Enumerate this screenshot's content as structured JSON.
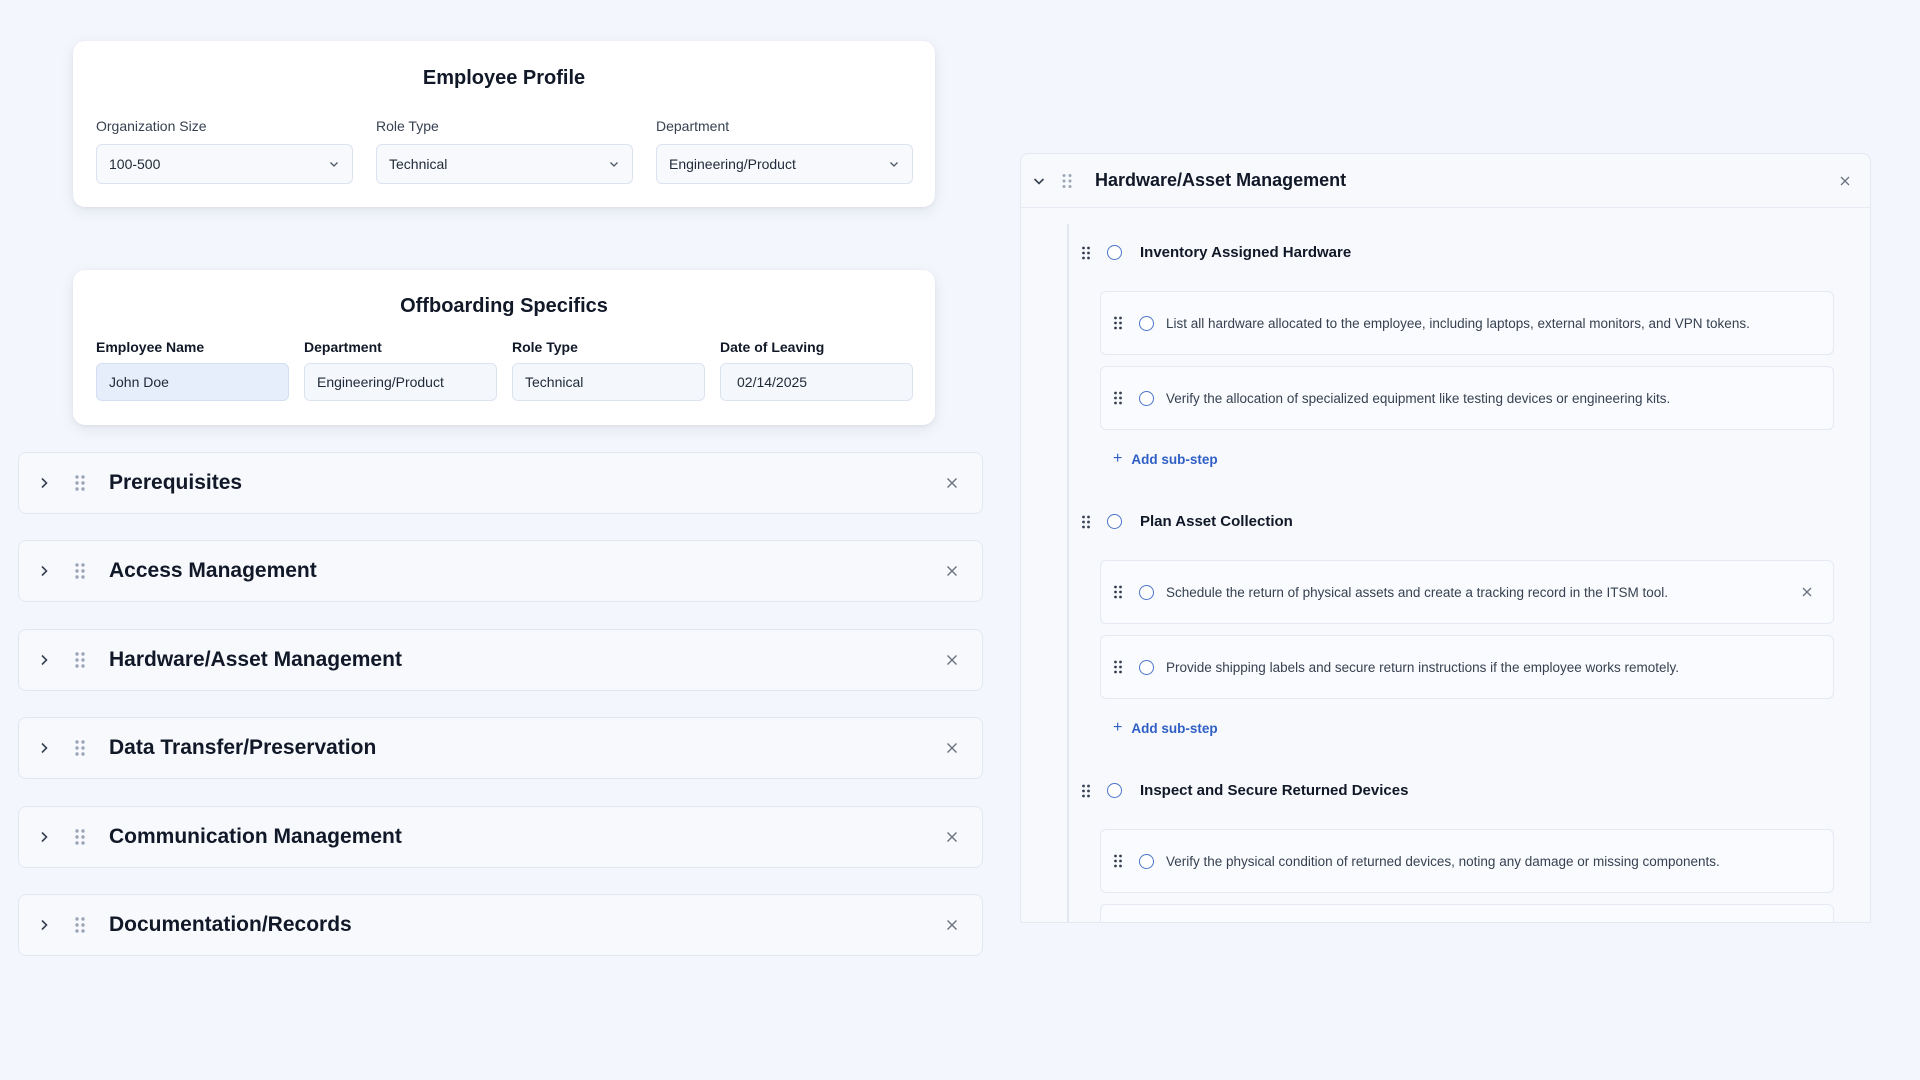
{
  "employee_profile": {
    "title": "Employee Profile",
    "fields": [
      {
        "label": "Organization Size",
        "value": "100-500"
      },
      {
        "label": "Role Type",
        "value": "Technical"
      },
      {
        "label": "Department",
        "value": "Engineering/Product"
      }
    ]
  },
  "offboarding": {
    "title": "Offboarding Specifics",
    "fields": [
      {
        "label": "Employee Name",
        "value": "John Doe"
      },
      {
        "label": "Department",
        "value": "Engineering/Product"
      },
      {
        "label": "Role Type",
        "value": "Technical"
      },
      {
        "label": "Date of Leaving",
        "value": "02/14/2025"
      }
    ]
  },
  "sections": [
    {
      "title": "Prerequisites"
    },
    {
      "title": "Access Management"
    },
    {
      "title": "Hardware/Asset Management"
    },
    {
      "title": "Data Transfer/Preservation"
    },
    {
      "title": "Communication Management"
    },
    {
      "title": "Documentation/Records"
    }
  ],
  "detail_panel": {
    "title": "Hardware/Asset Management",
    "steps": [
      {
        "title": "Inventory Assigned Hardware",
        "substeps": [
          "List all hardware allocated to the employee, including laptops, external monitors, and VPN tokens.",
          "Verify the allocation of specialized equipment like testing devices or engineering kits."
        ]
      },
      {
        "title": "Plan Asset Collection",
        "substeps": [
          "Schedule the return of physical assets and create a tracking record in the ITSM tool.",
          "Provide shipping labels and secure return instructions if the employee works remotely."
        ]
      },
      {
        "title": "Inspect and Secure Returned Devices",
        "substeps": [
          "Verify the physical condition of returned devices, noting any damage or missing components."
        ]
      }
    ],
    "add_substep_label": "Add sub-step"
  },
  "colors": {
    "background": "#f3f6fc",
    "accent": "#2f5fc4",
    "circle": "#4b74c9"
  }
}
